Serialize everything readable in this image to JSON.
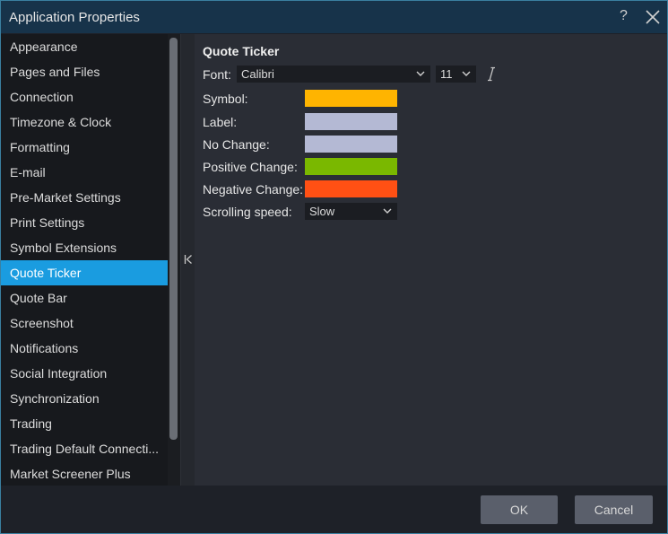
{
  "window": {
    "title": "Application Properties",
    "help_label": "?"
  },
  "sidebar": {
    "items": [
      {
        "label": "Appearance"
      },
      {
        "label": "Pages and Files"
      },
      {
        "label": "Connection"
      },
      {
        "label": "Timezone & Clock"
      },
      {
        "label": "Formatting"
      },
      {
        "label": "E-mail"
      },
      {
        "label": "Pre-Market Settings"
      },
      {
        "label": "Print Settings"
      },
      {
        "label": "Symbol Extensions"
      },
      {
        "label": "Quote Ticker"
      },
      {
        "label": "Quote Bar"
      },
      {
        "label": "Screenshot"
      },
      {
        "label": "Notifications"
      },
      {
        "label": "Social Integration"
      },
      {
        "label": "Synchronization"
      },
      {
        "label": "Trading"
      },
      {
        "label": "Trading Default Connecti..."
      },
      {
        "label": "Market Screener Plus"
      }
    ],
    "active_index": 9
  },
  "main": {
    "section_title": "Quote Ticker",
    "font_label": "Font:",
    "font_value": "Calibri",
    "font_size_value": "11",
    "symbol_label": "Symbol:",
    "label_label": "Label:",
    "no_change_label": "No Change:",
    "positive_change_label": "Positive Change:",
    "negative_change_label": "Negative Change:",
    "scrolling_speed_label": "Scrolling speed:",
    "scrolling_speed_value": "Slow"
  },
  "colors": {
    "symbol": "#ffb400",
    "label": "#b4b9d4",
    "no_change": "#b4b9d4",
    "positive_change": "#7ab800",
    "negative_change": "#ff5014",
    "active_item": "#1a9ce0"
  },
  "footer": {
    "ok_label": "OK",
    "cancel_label": "Cancel"
  }
}
